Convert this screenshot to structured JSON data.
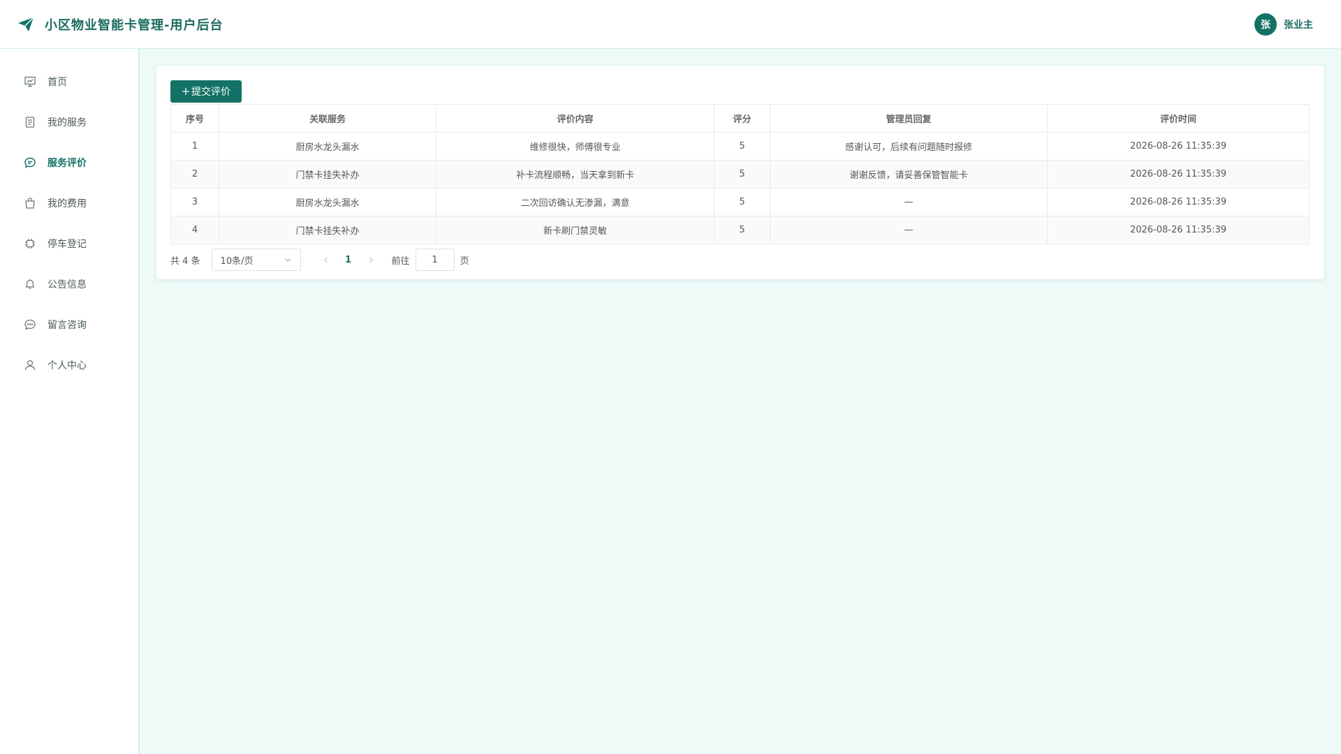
{
  "header": {
    "title": "小区物业智能卡管理-用户后台",
    "user": {
      "avatar_text": "张",
      "name": "张业主"
    }
  },
  "sidebar": {
    "items": [
      {
        "label": "首页",
        "icon": "presentation-icon"
      },
      {
        "label": "我的服务",
        "icon": "document-icon"
      },
      {
        "label": "服务评价",
        "icon": "chat-bubble-icon",
        "active": true
      },
      {
        "label": "我的费用",
        "icon": "shopping-bag-icon"
      },
      {
        "label": "停车登记",
        "icon": "chip-icon"
      },
      {
        "label": "公告信息",
        "icon": "bell-icon"
      },
      {
        "label": "留言咨询",
        "icon": "message-dots-icon"
      },
      {
        "label": "个人中心",
        "icon": "user-icon"
      }
    ]
  },
  "main": {
    "submit_button": "提交评价",
    "table": {
      "columns": [
        "序号",
        "关联服务",
        "评价内容",
        "评分",
        "管理员回复",
        "评价时间"
      ],
      "rows": [
        [
          "1",
          "厨房水龙头漏水",
          "维修很快，师傅很专业",
          "5",
          "感谢认可，后续有问题随时报修",
          "2026-08-26 11:35:39"
        ],
        [
          "2",
          "门禁卡挂失补办",
          "补卡流程顺畅，当天拿到新卡",
          "5",
          "谢谢反馈，请妥善保管智能卡",
          "2026-08-26 11:35:39"
        ],
        [
          "3",
          "厨房水龙头漏水",
          "二次回访确认无渗漏，满意",
          "5",
          "—",
          "2026-08-26 11:35:39"
        ],
        [
          "4",
          "门禁卡挂失补办",
          "新卡刷门禁灵敏",
          "5",
          "—",
          "2026-08-26 11:35:39"
        ]
      ]
    },
    "pagination": {
      "total": "共 4 条",
      "page_size": "10条/页",
      "current_page": "1",
      "goto_label": "前往",
      "goto_value": "1",
      "page_suffix": "页"
    }
  },
  "colors": {
    "primary": "#137265",
    "title": "#1a6b5e",
    "background": "#eefaf8"
  }
}
